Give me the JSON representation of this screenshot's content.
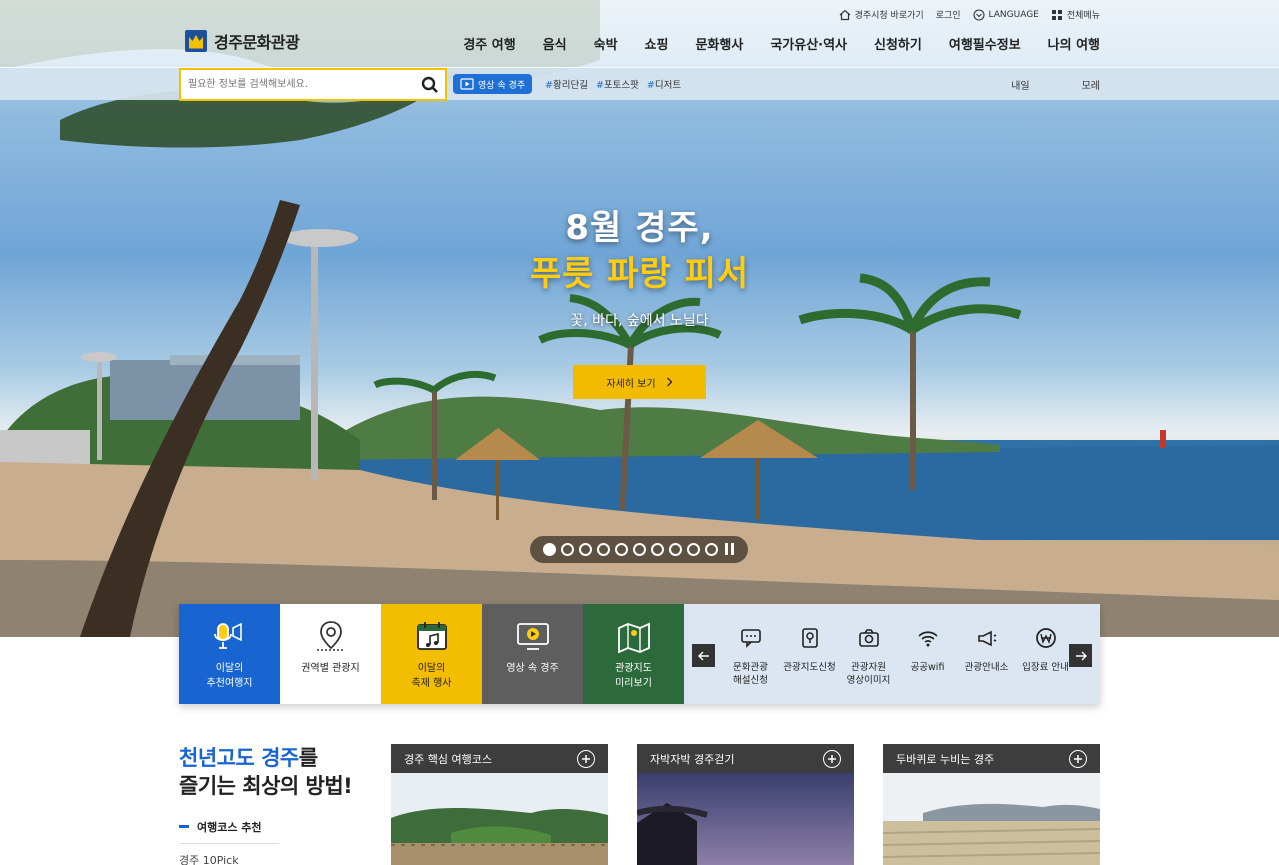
{
  "header": {
    "util": [
      {
        "label": "경주시청 바로가기",
        "icon": "home-icon"
      },
      {
        "label": "로그인",
        "icon": ""
      },
      {
        "label": "LANGUAGE",
        "icon": "language-icon"
      },
      {
        "label": "전체메뉴",
        "icon": "grid-menu-icon"
      }
    ],
    "logo_text": "경주문화관광",
    "gnb": [
      "경주 여행",
      "음식",
      "숙박",
      "쇼핑",
      "문화행사",
      "국가유산·역사",
      "신청하기",
      "여행필수정보",
      "나의 여행"
    ],
    "search": {
      "placeholder": "필요한 정보를 검색해보세요."
    },
    "video_tag": "영상 속 경주",
    "hashtags": [
      "황리단길",
      "포토스팟",
      "디저트"
    ],
    "weather": [
      "내일",
      "모레"
    ]
  },
  "hero": {
    "title_line1": "8월 경주,",
    "title_line2": "푸릇 파랑 피서",
    "subtitle": "꽃, 바다, 숲에서 노닐다",
    "button_label": "자세히 보기",
    "slides_total": 10,
    "slide_active": 1,
    "colors": {
      "accent": "#f2bb00",
      "title_yellow": "#ffcc10"
    }
  },
  "quick": {
    "tiles": [
      {
        "label": "이달의\n추천여행지",
        "icon": "microphone-icon",
        "color": "#1864d0"
      },
      {
        "label": "권역별 관광지",
        "icon": "map-pin-icon",
        "color": "#ffffff"
      },
      {
        "label": "이달의\n축제 행사",
        "icon": "calendar-music-icon",
        "color": "#f3bd00"
      },
      {
        "label": "영상 속 경주",
        "icon": "video-screen-icon",
        "color": "#5e5e5e"
      },
      {
        "label": "관광지도\n미리보기",
        "icon": "folded-map-icon",
        "color": "#2c6a3c"
      }
    ],
    "services": [
      {
        "label": "문화관광\n해설신청",
        "icon": "speech-bubble-icon"
      },
      {
        "label": "관광지도신청",
        "icon": "map-location-icon"
      },
      {
        "label": "관광자원\n영상이미지",
        "icon": "camera-icon"
      },
      {
        "label": "공공wifi",
        "icon": "wifi-icon"
      },
      {
        "label": "관광안내소",
        "icon": "megaphone-icon"
      },
      {
        "label": "입장료 안내",
        "icon": "won-coin-icon"
      }
    ]
  },
  "bottom": {
    "intro_title_blue": "천년고도 경주",
    "intro_title_rest1": "를",
    "intro_title_line2": "즐기는 최상의 방법!",
    "course_heading": "여행코스 추천",
    "course_first": "경주 10Pick",
    "cards": [
      {
        "title": "경주 핵심 여행코스"
      },
      {
        "title": "자박자박 경주걷기"
      },
      {
        "title": "두바퀴로 누비는 경주"
      }
    ]
  }
}
